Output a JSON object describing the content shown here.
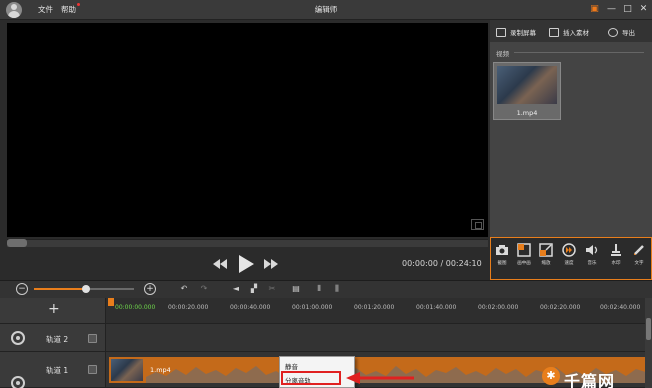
{
  "window": {
    "title": "编辑师",
    "menu": [
      "文件",
      "帮助"
    ],
    "controls": [
      "▣",
      "—",
      "□",
      "✕"
    ]
  },
  "colors": {
    "accent": "#e87e1c",
    "background": "#2b2b2b",
    "annotation": "#e02020"
  },
  "right_panel": {
    "tabs": [
      {
        "label": "录制屏幕",
        "icon": "record-screen-icon"
      },
      {
        "label": "插入素材",
        "icon": "insert-media-icon"
      },
      {
        "label": "导出",
        "icon": "export-film-reel-icon"
      }
    ],
    "section_label": "视频",
    "media": [
      {
        "name": "1.mp4"
      }
    ]
  },
  "player": {
    "time_current": "00:00:00",
    "time_separator": "/",
    "time_total": "00:24:10"
  },
  "tools": [
    {
      "label": "截图",
      "icon": "camera-icon"
    },
    {
      "label": "画中画",
      "icon": "picture-in-picture-icon"
    },
    {
      "label": "缩放",
      "icon": "zoom-expand-icon"
    },
    {
      "label": "速度",
      "icon": "speed-icon"
    },
    {
      "label": "音乐",
      "icon": "speaker-icon"
    },
    {
      "label": "水印",
      "icon": "stamp-icon"
    },
    {
      "label": "文字",
      "icon": "pen-text-icon"
    }
  ],
  "timeline": {
    "add_symbol": "+",
    "ticks": [
      "00:00:00.000",
      "00:00:20.000",
      "00:00:40.000",
      "00:01:00.000",
      "00:01:20.000",
      "00:01:40.000",
      "00:02:00.000",
      "00:02:20.000",
      "00:02:40.000"
    ],
    "tracks": [
      {
        "label": "轨道 2"
      },
      {
        "label": "轨道 1",
        "clip": "1.mp4"
      }
    ]
  },
  "context_menu": {
    "items": [
      "静音",
      "分离音轨"
    ],
    "highlighted_index": 1
  },
  "watermark": {
    "text": "千篇网"
  }
}
